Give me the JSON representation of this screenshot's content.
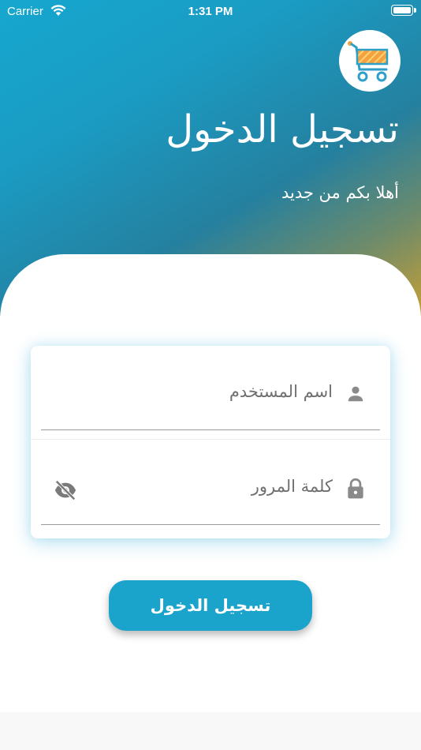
{
  "status_bar": {
    "carrier": "Carrier",
    "time": "1:31 PM"
  },
  "header": {
    "title": "تسجيل الدخول",
    "subtitle": "أهلا بكم من جديد"
  },
  "form": {
    "username_label": "اسم المستخدم",
    "password_label": "كلمة المرور"
  },
  "login_button": {
    "label": "تسجيل الدخول"
  },
  "colors": {
    "accent": "#1aa4cc",
    "cart_orange": "#f5a23c",
    "cart_frame": "#2e9fc8",
    "field_text": "#707070"
  },
  "icons": {
    "cart": "shopping-cart-icon",
    "user": "person-icon",
    "lock": "lock-icon",
    "eye": "eye-off-icon"
  }
}
